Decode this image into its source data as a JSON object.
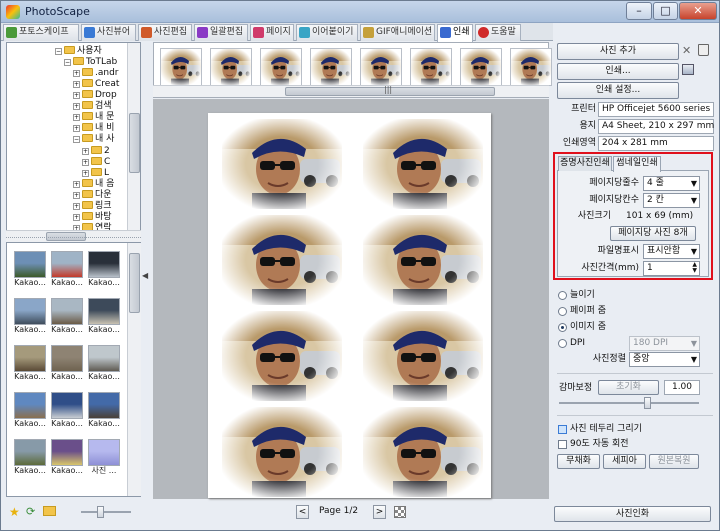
{
  "window": {
    "title": "PhotoScape"
  },
  "tabs": [
    {
      "label": "포토스케이프",
      "color": "#4a9a3a"
    },
    {
      "label": "사진뷰어",
      "color": "#3a7ad5"
    },
    {
      "label": "사진편집",
      "color": "#d05a2a"
    },
    {
      "label": "일괄편집",
      "color": "#8a3ac5"
    },
    {
      "label": "페이지",
      "color": "#d03a6a"
    },
    {
      "label": "이어붙이기",
      "color": "#3aa5c5"
    },
    {
      "label": "GIF애니메이션",
      "color": "#c5a03a"
    },
    {
      "label": "인쇄",
      "color": "#3a6ad0"
    },
    {
      "label": "도움말",
      "color": "#d02a2a"
    }
  ],
  "tree": {
    "nodes": [
      {
        "label": "사용자",
        "depth": 4
      },
      {
        "label": "ToTLab",
        "depth": 5
      },
      {
        "label": ".andr",
        "depth": 6
      },
      {
        "label": "Creat",
        "depth": 6
      },
      {
        "label": "Drop",
        "depth": 6
      },
      {
        "label": "검색",
        "depth": 6
      },
      {
        "label": "내 문",
        "depth": 6
      },
      {
        "label": "내 비",
        "depth": 6
      },
      {
        "label": "내 사",
        "depth": 6
      },
      {
        "label": "2",
        "depth": 7
      },
      {
        "label": "C",
        "depth": 7
      },
      {
        "label": "L",
        "depth": 7
      },
      {
        "label": "내 음",
        "depth": 6
      },
      {
        "label": "다운",
        "depth": 6
      },
      {
        "label": "링크",
        "depth": 6
      },
      {
        "label": "바탕",
        "depth": 6
      },
      {
        "label": "연락",
        "depth": 6
      }
    ]
  },
  "thumbnails": [
    {
      "label": "Kakao...",
      "c1": "#6d8fb5",
      "c2": "#3c5a2a"
    },
    {
      "label": "Kakao...",
      "c1": "#9fb3c6",
      "c2": "#c43a2a"
    },
    {
      "label": "Kakao...",
      "c1": "#29303a",
      "c2": "#b8c0c9"
    },
    {
      "label": "Kakao...",
      "c1": "#8aa6c8",
      "c2": "#3f4d5c"
    },
    {
      "label": "Kakao...",
      "c1": "#a9b7c3",
      "c2": "#6a5a46"
    },
    {
      "label": "Kakao...",
      "c1": "#3d4a5a",
      "c2": "#c8c1b2"
    },
    {
      "label": "Kakao...",
      "c1": "#a59a7c",
      "c2": "#5a4a36"
    },
    {
      "label": "Kakao...",
      "c1": "#8e8373",
      "c2": "#6e624f"
    },
    {
      "label": "Kakao...",
      "c1": "#bfc7cc",
      "c2": "#5e5a52"
    },
    {
      "label": "Kakao...",
      "c1": "#5f88c0",
      "c2": "#8a6f4f"
    },
    {
      "label": "Kakao...",
      "c1": "#2f4e88",
      "c2": "#c9cdd2"
    },
    {
      "label": "Kakao...",
      "c1": "#436aa8",
      "c2": "#4a4038"
    },
    {
      "label": "Kakao...",
      "c1": "#879aa8",
      "c2": "#5c6a3a"
    },
    {
      "label": "Kakao...",
      "c1": "#6a4f8a",
      "c2": "#d8c56a"
    },
    {
      "label": "사진 ...",
      "c1": "#b6b9ee",
      "c2": "#8d8fd6"
    }
  ],
  "canvas": {
    "page_label": "Page 1/2",
    "prev": "<",
    "next": ">"
  },
  "right": {
    "add_photo": "사진 추가",
    "print": "인쇄...",
    "print_setup": "인쇄 설정...",
    "printer_label": "프린터",
    "printer_value": "HP Officejet 5600 series",
    "paper_label": "용지",
    "paper_value": "A4 Sheet, 210 x 297 mm",
    "area_label": "인쇄영역",
    "area_value": "204 x 281 mm",
    "tab_id": "증명사진인쇄",
    "tab_thumb": "썸네일인쇄",
    "rows_label": "페이지당줄수",
    "rows_value": "4 줄",
    "cols_label": "페이지당칸수",
    "cols_value": "2 칸",
    "size_label": "사진크기",
    "size_value": "101 x 69 (mm)",
    "per_page": "페이지당 사진 8개",
    "filename_label": "파일명표시",
    "filename_value": "표시안함",
    "gap_label": "사진간격(mm)",
    "gap_value": "1",
    "opt_fit": "늘이기",
    "opt_paper": "페이퍼 줌",
    "opt_image": "이미지 줌",
    "opt_dpi": "DPI",
    "dpi_value": "180 DPI",
    "align_label": "사진정렬",
    "align_value": "중앙",
    "gamma_label": "감마보정",
    "gamma_reset": "초기화",
    "gamma_value": "1.00",
    "border_label": "사진 테두리 그리기",
    "rotate_label": "90도 자동 회전",
    "mono": "무채화",
    "sepia": "세피아",
    "restore": "원본복원",
    "save_photo": "사진인화"
  }
}
